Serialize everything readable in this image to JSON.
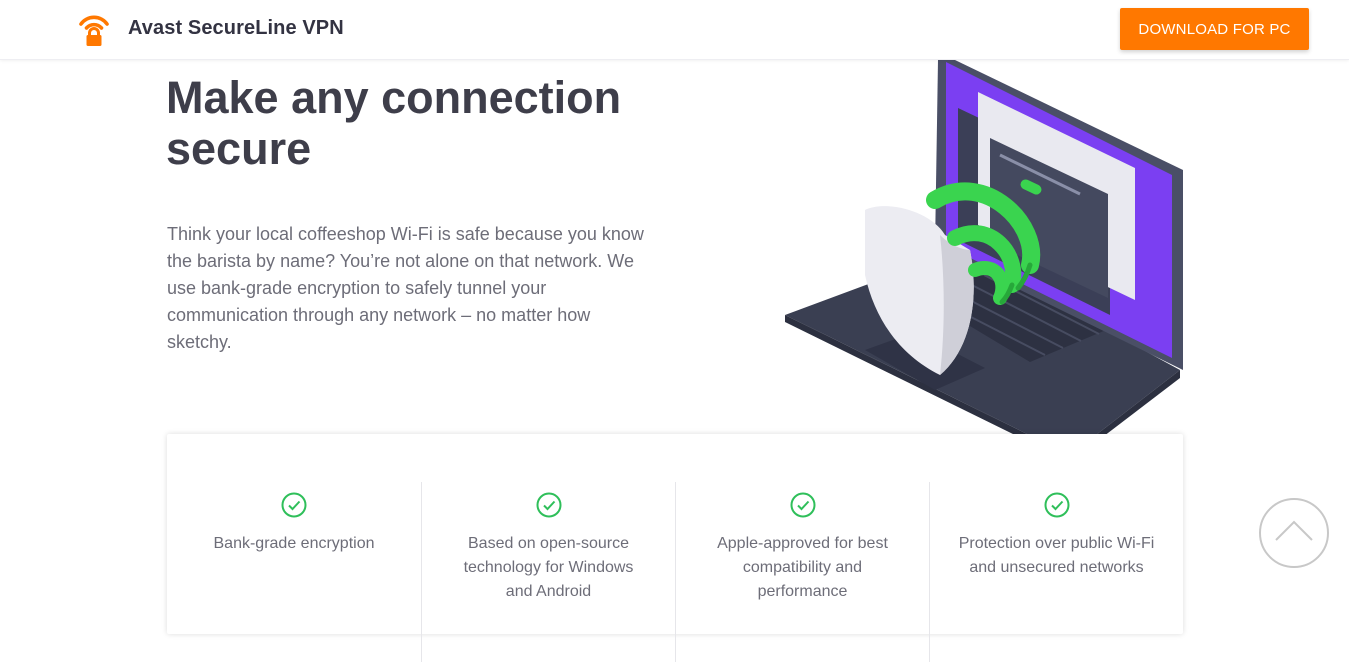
{
  "header": {
    "brand": "Avast SecureLine VPN",
    "download_label": "DOWNLOAD FOR PC",
    "logo_icon": "wifi-lock-icon"
  },
  "hero": {
    "title": "Make any connection secure",
    "text": "Think your local coffeeshop Wi-Fi is safe because you know the barista by name? You’re not alone on that network. We use bank-grade encryption to safely tunnel your communication through any network – no matter how sketchy."
  },
  "features": [
    {
      "icon": "check-circle-icon",
      "label": "Bank-grade encryption"
    },
    {
      "icon": "check-circle-icon",
      "label": "Based on open-source technology for Windows and Android"
    },
    {
      "icon": "check-circle-icon",
      "label": "Apple-approved for best compatibility and performance"
    },
    {
      "icon": "check-circle-icon",
      "label": "Protection over public Wi-Fi and unsecured networks"
    }
  ],
  "scroll_top_icon": "chevron-up-icon",
  "colors": {
    "accent": "#ff7800",
    "check": "#2fbf5a",
    "laptop_dark": "#3a3f52",
    "screen_purple": "#7b3ff2",
    "wifi_green": "#3ad44f"
  }
}
